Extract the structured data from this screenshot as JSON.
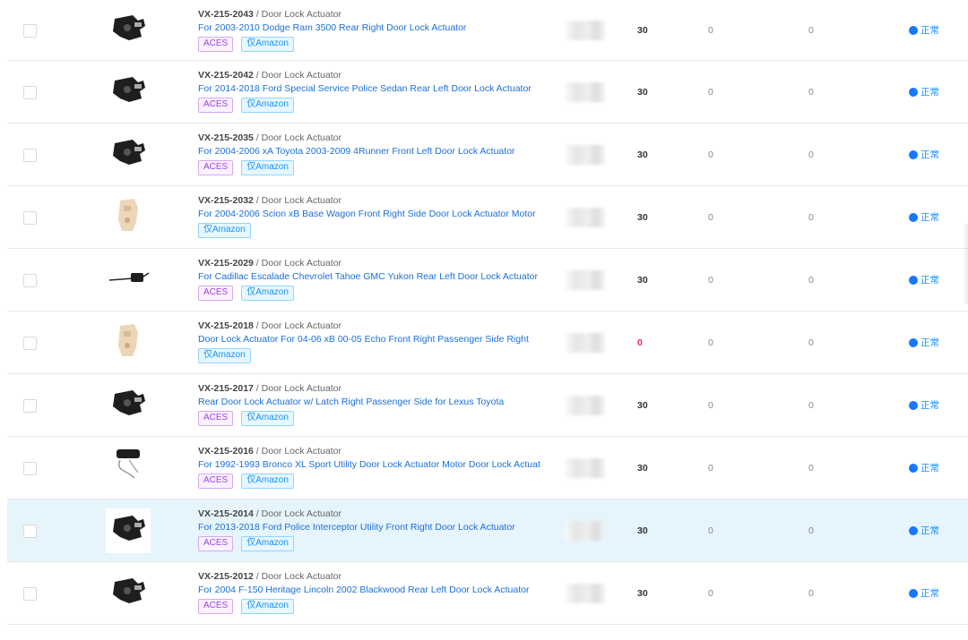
{
  "rows": [
    {
      "sku": "VX-215-2043",
      "category": "Door Lock Actuator",
      "title": "For 2003-2010 Dodge Ram 3500 Rear Right Door Lock Actuator",
      "tags": [
        "ACES",
        "仅Amazon"
      ],
      "stock": "30",
      "col2": "0",
      "col3": "0",
      "status": "正常",
      "stock_zero": false,
      "image_icon": "black-actuator-image"
    },
    {
      "sku": "VX-215-2042",
      "category": "Door Lock Actuator",
      "title": "For 2014-2018 Ford Special Service Police Sedan Rear Left Door Lock Actuator",
      "tags": [
        "ACES",
        "仅Amazon"
      ],
      "stock": "30",
      "col2": "0",
      "col3": "0",
      "status": "正常",
      "stock_zero": false,
      "image_icon": "black-actuator-image"
    },
    {
      "sku": "VX-215-2035",
      "category": "Door Lock Actuator",
      "title": "For 2004-2006 xA Toyota 2003-2009 4Runner Front Left Door Lock Actuator",
      "tags": [
        "ACES",
        "仅Amazon"
      ],
      "stock": "30",
      "col2": "0",
      "col3": "0",
      "status": "正常",
      "stock_zero": false,
      "image_icon": "black-actuator-image"
    },
    {
      "sku": "VX-215-2032",
      "category": "Door Lock Actuator",
      "title": "For 2004-2006 Scion xB Base Wagon Front Right Side Door Lock Actuator Motor",
      "tags": [
        "仅Amazon"
      ],
      "stock": "30",
      "col2": "0",
      "col3": "0",
      "status": "正常",
      "stock_zero": false,
      "image_icon": "beige-actuator-image"
    },
    {
      "sku": "VX-215-2029",
      "category": "Door Lock Actuator",
      "title": "For Cadillac Escalade Chevrolet Tahoe GMC Yukon Rear Left Door Lock Actuator",
      "tags": [
        "ACES",
        "仅Amazon"
      ],
      "stock": "30",
      "col2": "0",
      "col3": "0",
      "status": "正常",
      "stock_zero": false,
      "image_icon": "cable-actuator-image"
    },
    {
      "sku": "VX-215-2018",
      "category": "Door Lock Actuator",
      "title": "Door Lock Actuator For 04-06 xB 00-05 Echo Front Right Passenger Side Right",
      "tags": [
        "仅Amazon"
      ],
      "stock": "0",
      "col2": "0",
      "col3": "0",
      "status": "正常",
      "stock_zero": true,
      "image_icon": "beige-actuator-image"
    },
    {
      "sku": "VX-215-2017",
      "category": "Door Lock Actuator",
      "title": "Rear Door Lock Actuator w/ Latch Right Passenger Side for Lexus Toyota",
      "tags": [
        "ACES",
        "仅Amazon"
      ],
      "stock": "30",
      "col2": "0",
      "col3": "0",
      "status": "正常",
      "stock_zero": false,
      "image_icon": "black-actuator-image"
    },
    {
      "sku": "VX-215-2016",
      "category": "Door Lock Actuator",
      "title": "For 1992-1993 Bronco XL Sport Utility Door Lock Actuator Motor Door Lock Actuat",
      "tags": [
        "ACES",
        "仅Amazon"
      ],
      "stock": "30",
      "col2": "0",
      "col3": "0",
      "status": "正常",
      "stock_zero": false,
      "image_icon": "rods-actuator-image"
    },
    {
      "sku": "VX-215-2014",
      "category": "Door Lock Actuator",
      "title": "For 2013-2018 Ford Police Interceptor Utility Front Right Door Lock Actuator",
      "tags": [
        "ACES",
        "仅Amazon"
      ],
      "stock": "30",
      "col2": "0",
      "col3": "0",
      "status": "正常",
      "stock_zero": false,
      "image_icon": "black-actuator-image"
    },
    {
      "sku": "VX-215-2012",
      "category": "Door Lock Actuator",
      "title": "For 2004 F-150 Heritage Lincoln 2002 Blackwood Rear Left Door Lock Actuator",
      "tags": [
        "ACES",
        "仅Amazon"
      ],
      "stock": "30",
      "col2": "0",
      "col3": "0",
      "status": "正常",
      "stock_zero": false,
      "image_icon": "black-actuator-image"
    }
  ],
  "selected_row_index": 8,
  "colors": {
    "link": "#1a6fd8",
    "status_dot": "#1677ff",
    "zero_stock": "#f0245c",
    "selected_bg": "#e6f4fc"
  }
}
